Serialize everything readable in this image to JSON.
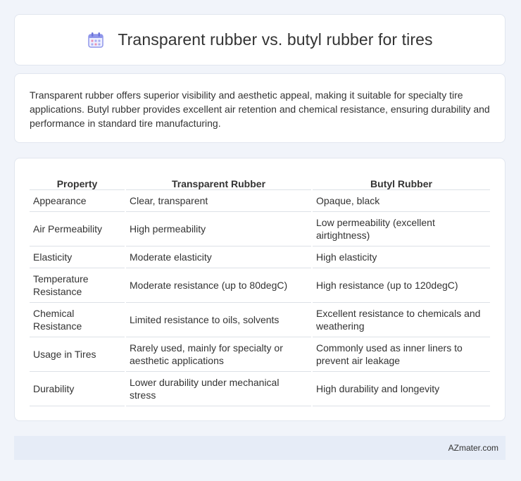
{
  "header": {
    "title": "Transparent rubber vs. butyl rubber for tires",
    "icon": "calendar-icon"
  },
  "summary": {
    "text": "Transparent rubber offers superior visibility and aesthetic appeal, making it suitable for specialty tire applications. Butyl rubber provides excellent air retention and chemical resistance, ensuring durability and performance in standard tire manufacturing."
  },
  "table": {
    "columns": [
      "Property",
      "Transparent Rubber",
      "Butyl Rubber"
    ],
    "rows": [
      [
        "Appearance",
        "Clear, transparent",
        "Opaque, black"
      ],
      [
        "Air Permeability",
        "High permeability",
        "Low permeability (excellent airtightness)"
      ],
      [
        "Elasticity",
        "Moderate elasticity",
        "High elasticity"
      ],
      [
        "Temperature Resistance",
        "Moderate resistance (up to 80degC)",
        "High resistance (up to 120degC)"
      ],
      [
        "Chemical Resistance",
        "Limited resistance to oils, solvents",
        "Excellent resistance to chemicals and weathering"
      ],
      [
        "Usage in Tires",
        "Rarely used, mainly for specialty or aesthetic applications",
        "Commonly used as inner liners to prevent air leakage"
      ],
      [
        "Durability",
        "Lower durability under mechanical stress",
        "High durability and longevity"
      ]
    ]
  },
  "footer": {
    "brand": "AZmater.com"
  },
  "colors": {
    "background": "#f1f4fa",
    "card": "#ffffff",
    "footer": "#e6ecf7",
    "icon_accent": "#7b83e6"
  }
}
